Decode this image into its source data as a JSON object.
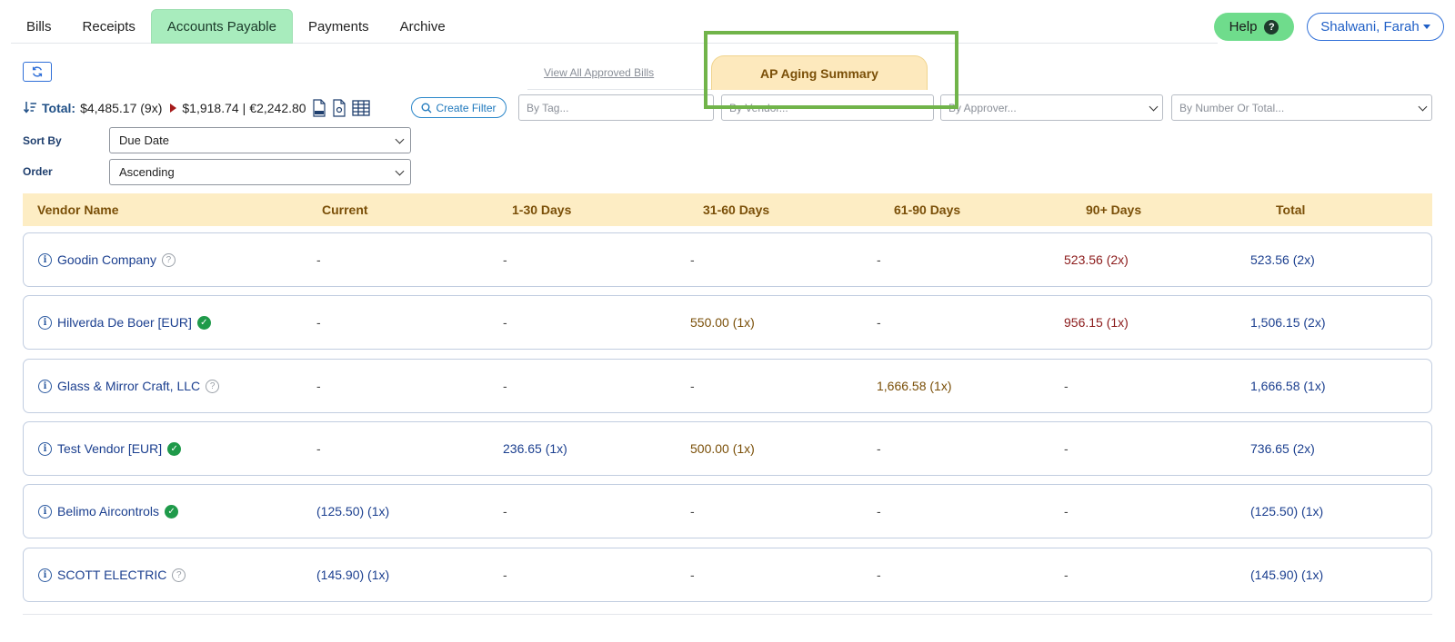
{
  "nav": {
    "tabs": [
      {
        "label": "Bills"
      },
      {
        "label": "Receipts"
      },
      {
        "label": "Accounts Payable"
      },
      {
        "label": "Payments"
      },
      {
        "label": "Archive"
      }
    ],
    "active_tab": "Accounts Payable",
    "help_label": "Help",
    "user_label": "Shalwani, Farah"
  },
  "view_all_label": "View All Approved Bills",
  "aging_tab_label": "AP Aging Summary",
  "totals": {
    "label": "Total:",
    "usd_total": "$4,485.17 (9x)",
    "usd_sub": "$1,918.74",
    "separator": "|",
    "eur_total": "€2,242.80"
  },
  "create_filter_label": "Create Filter",
  "filters": {
    "tag_placeholder": "By Tag...",
    "vendor_placeholder": "By Vendor...",
    "approver_placeholder": "By Approver...",
    "number_placeholder": "By Number Or Total..."
  },
  "sort": {
    "sort_by_label": "Sort By",
    "sort_by_value": "Due Date",
    "order_label": "Order",
    "order_value": "Ascending"
  },
  "table": {
    "headers": {
      "vendor": "Vendor Name",
      "current": "Current",
      "d30": "1-30 Days",
      "d60": "31-60 Days",
      "d90": "61-90 Days",
      "d90p": "90+ Days",
      "total": "Total"
    },
    "rows": [
      {
        "vendor": "Goodin Company",
        "status": "unverified",
        "current": "-",
        "d30": "-",
        "d60": "-",
        "d90": "-",
        "d90p": "523.56 (2x)",
        "total": "523.56 (2x)"
      },
      {
        "vendor": "Hilverda De Boer [EUR]",
        "status": "verified",
        "current": "-",
        "d30": "-",
        "d60": "550.00 (1x)",
        "d90": "-",
        "d90p": "956.15 (1x)",
        "total": "1,506.15 (2x)"
      },
      {
        "vendor": "Glass & Mirror Craft, LLC",
        "status": "unverified",
        "current": "-",
        "d30": "-",
        "d60": "-",
        "d90": "1,666.58 (1x)",
        "d90p": "-",
        "total": "1,666.58 (1x)"
      },
      {
        "vendor": "Test Vendor [EUR]",
        "status": "verified",
        "current": "-",
        "d30": "236.65 (1x)",
        "d60": "500.00 (1x)",
        "d90": "-",
        "d90p": "-",
        "total": "736.65 (2x)"
      },
      {
        "vendor": "Belimo Aircontrols",
        "status": "verified",
        "current": "(125.50) (1x)",
        "d30": "-",
        "d60": "-",
        "d90": "-",
        "d90p": "-",
        "total": "(125.50) (1x)"
      },
      {
        "vendor": "SCOTT ELECTRIC",
        "status": "unverified",
        "current": "(145.90) (1x)",
        "d30": "-",
        "d60": "-",
        "d90": "-",
        "d90p": "-",
        "total": "(145.90) (1x)"
      }
    ]
  },
  "colors": {
    "accent_green": "#a8ecbd",
    "help_green": "#6fdc8c",
    "header_bg": "#fdedc4",
    "gold_text": "#7a4f08",
    "red_text": "#8b1a1a",
    "navy_text": "#1b3f8f",
    "highlight_box": "#71b44a"
  }
}
